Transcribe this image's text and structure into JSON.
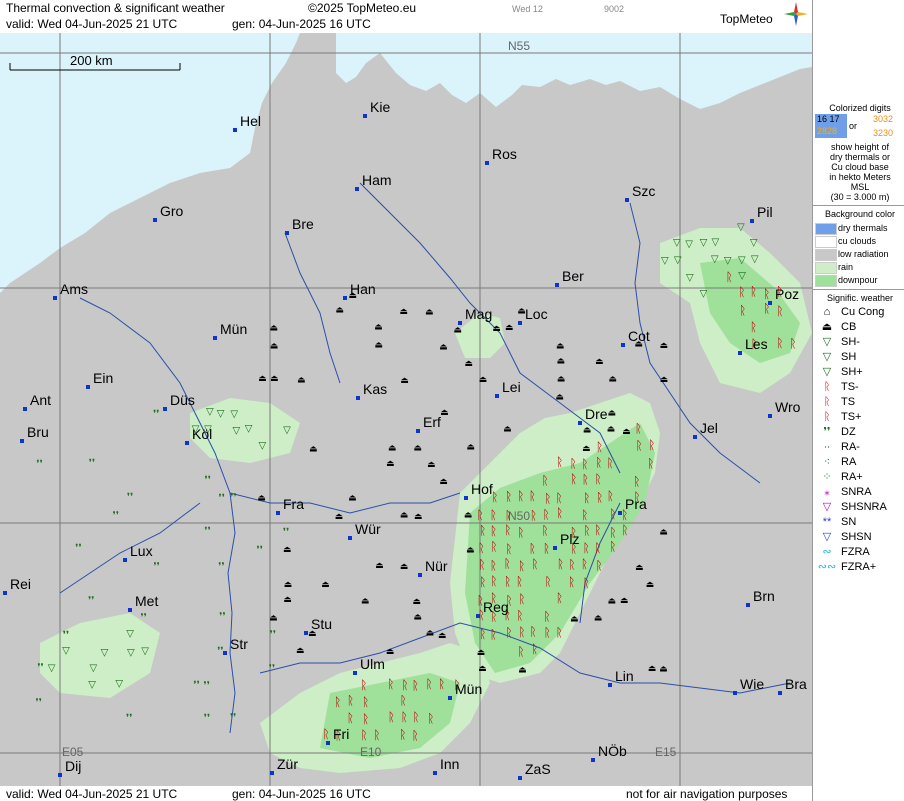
{
  "header": {
    "title": "Thermal convection & significant weather",
    "copyright": "©2025 TopMeteo.eu",
    "day_code": "Wed 12",
    "code2": "9002",
    "valid": "valid:  Wed  04-Jun-2025  21 UTC",
    "gen": "gen: 04-Jun-2025 16 UTC",
    "logo": "TopMeteo"
  },
  "footer": {
    "valid": "valid:  Wed  04-Jun-2025  21 UTC",
    "gen": "gen: 04-Jun-2025 16 UTC",
    "disclaimer": "not for air navigation purposes"
  },
  "map": {
    "scale_label": "200 km",
    "colors": {
      "sea": "#dbf3fb",
      "land": "#c8c8c8",
      "light_rain": "#cdeec7",
      "downpour": "#9fe09a",
      "river": "#2a4fa8",
      "grid": "#7a7a7a",
      "city": "#1033d0",
      "ts": "#b80000",
      "sh": "#1c6e1c"
    },
    "grid_labels": [
      {
        "text": "N55",
        "lat": 55,
        "lon": 10
      },
      {
        "text": "N50",
        "lat": 50,
        "lon": 10
      },
      {
        "text": "E05",
        "lat": 46.7,
        "lon": 5
      },
      {
        "text": "E10",
        "lat": 46.7,
        "lon": 10
      },
      {
        "text": "E15",
        "lat": 46.7,
        "lon": 15
      }
    ],
    "cities": [
      {
        "name": "Hel"
      },
      {
        "name": "Kie"
      },
      {
        "name": "Ros"
      },
      {
        "name": "Szc"
      },
      {
        "name": "Ham"
      },
      {
        "name": "Gro"
      },
      {
        "name": "Bre"
      },
      {
        "name": "Pil"
      },
      {
        "name": "Ber"
      },
      {
        "name": "Ams"
      },
      {
        "name": "Han"
      },
      {
        "name": "Poz"
      },
      {
        "name": "Mag"
      },
      {
        "name": "Loc"
      },
      {
        "name": "Mün"
      },
      {
        "name": "Cot"
      },
      {
        "name": "Les"
      },
      {
        "name": "Ein"
      },
      {
        "name": "Kas"
      },
      {
        "name": "Lei"
      },
      {
        "name": "Ant"
      },
      {
        "name": "Düs"
      },
      {
        "name": "Wro"
      },
      {
        "name": "Bru"
      },
      {
        "name": "Köl"
      },
      {
        "name": "Erf"
      },
      {
        "name": "Dre"
      },
      {
        "name": "Jel"
      },
      {
        "name": "Hof"
      },
      {
        "name": "Fra"
      },
      {
        "name": "Pra"
      },
      {
        "name": "Wür"
      },
      {
        "name": "Plz"
      },
      {
        "name": "Lux"
      },
      {
        "name": "Nür"
      },
      {
        "name": "Rei"
      },
      {
        "name": "Met"
      },
      {
        "name": "Brn"
      },
      {
        "name": "Reg"
      },
      {
        "name": "Stu"
      },
      {
        "name": "Str"
      },
      {
        "name": "Ulm"
      },
      {
        "name": "Lin"
      },
      {
        "name": "Wie"
      },
      {
        "name": "Bra"
      },
      {
        "name": "Mün"
      },
      {
        "name": "Fri"
      },
      {
        "name": "NÖb"
      },
      {
        "name": "Zür"
      },
      {
        "name": "Dij"
      },
      {
        "name": "Inn"
      },
      {
        "name": "ZaS"
      }
    ]
  },
  "legend": {
    "digits_title": "Colorized digits",
    "digits_blue": "16 17",
    "digits_green": "2828",
    "digits_or": "or",
    "digits_orange1": "3032",
    "digits_orange2": "3230",
    "digits_desc": [
      "show height of",
      "dry thermals or",
      "Cu cloud base",
      "in hekto Meters",
      "MSL",
      "(30 = 3.000 m)"
    ],
    "bg_title": "Background color",
    "bg_items": [
      {
        "label": "dry thermals",
        "color": "#6f9fe8"
      },
      {
        "label": "cu clouds",
        "color": "#ffffff"
      },
      {
        "label": "low radiation",
        "color": "#c8c8c8"
      },
      {
        "label": "rain",
        "color": "#cdeec7"
      },
      {
        "label": "downpour",
        "color": "#9fe09a"
      }
    ],
    "wx_title": "Signific. weather",
    "wx_items": [
      {
        "code": "Cu Cong",
        "icon": "cucong-icon",
        "glyph": "⌂",
        "color": "#000"
      },
      {
        "code": "CB",
        "icon": "cb-icon",
        "glyph": "⏏",
        "color": "#000"
      },
      {
        "code": "SH-",
        "icon": "shower-light-icon",
        "glyph": "▽",
        "color": "#1c6e1c"
      },
      {
        "code": "SH",
        "icon": "shower-icon",
        "glyph": "▽",
        "color": "#1c6e1c"
      },
      {
        "code": "SH+",
        "icon": "shower-heavy-icon",
        "glyph": "▽",
        "color": "#1c6e1c"
      },
      {
        "code": "TS-",
        "icon": "thunder-light-icon",
        "glyph": "ᚱ",
        "color": "#b80000"
      },
      {
        "code": "TS",
        "icon": "thunder-icon",
        "glyph": "ᚱ",
        "color": "#b80000"
      },
      {
        "code": "TS+",
        "icon": "thunder-heavy-icon",
        "glyph": "ᚱ",
        "color": "#b80000"
      },
      {
        "code": "DZ",
        "icon": "drizzle-icon",
        "glyph": "❜❜",
        "color": "#1c6e1c"
      },
      {
        "code": "RA-",
        "icon": "rain-light-icon",
        "glyph": "∙∙",
        "color": "#1c6e1c"
      },
      {
        "code": "RA",
        "icon": "rain-icon",
        "glyph": "⁖",
        "color": "#1c6e1c"
      },
      {
        "code": "RA+",
        "icon": "rain-heavy-icon",
        "glyph": "⁘",
        "color": "#1c6e1c"
      },
      {
        "code": "SNRA",
        "icon": "snowrain-icon",
        "glyph": "⁎",
        "color": "#c400c4"
      },
      {
        "code": "SHSNRA",
        "icon": "shower-snowrain-icon",
        "glyph": "▽",
        "color": "#c400c4"
      },
      {
        "code": "SN",
        "icon": "snow-icon",
        "glyph": "**",
        "color": "#2a3fd0"
      },
      {
        "code": "SHSN",
        "icon": "shower-snow-icon",
        "glyph": "▽",
        "color": "#2a3fd0"
      },
      {
        "code": "FZRA",
        "icon": "freezing-rain-icon",
        "glyph": "∾",
        "color": "#18b8e8"
      },
      {
        "code": "FZRA+",
        "icon": "freezing-rain-heavy-icon",
        "glyph": "∾∾",
        "color": "#18b8e8"
      }
    ]
  }
}
